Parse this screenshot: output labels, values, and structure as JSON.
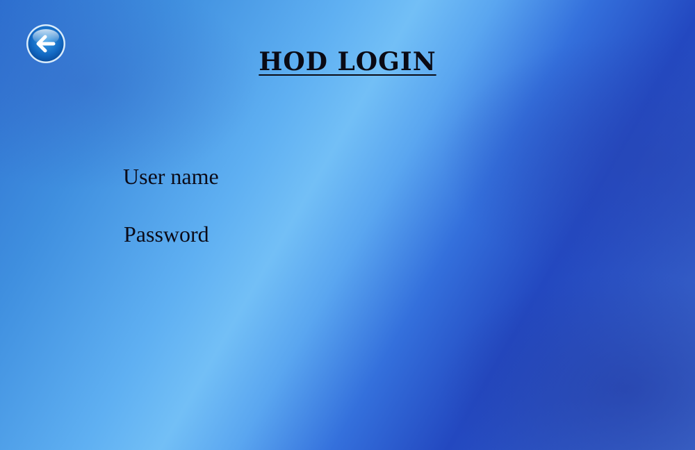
{
  "header": {
    "title": "HOD LOGIN",
    "back_icon": "arrow-left-circle-icon"
  },
  "form": {
    "username_label": "User name",
    "password_label": "Password"
  },
  "colors": {
    "background_primary": "#2f64d2",
    "background_highlight": "#72bff6",
    "text": "#0b0b18"
  }
}
